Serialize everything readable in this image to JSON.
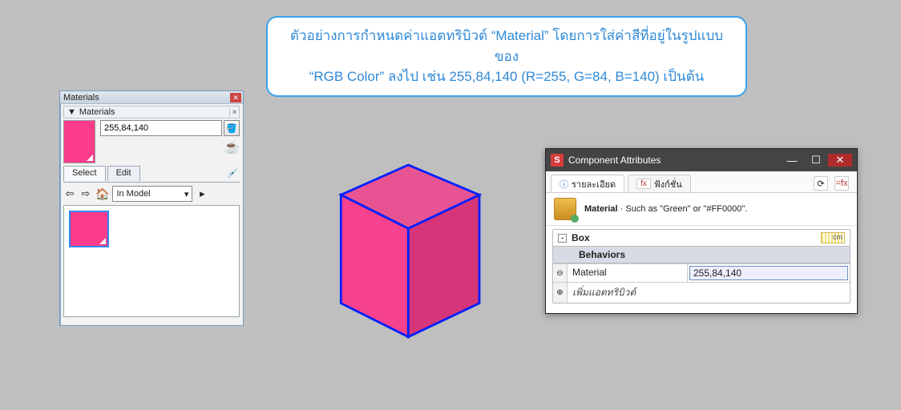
{
  "caption": {
    "line1": "ตัวอย่างการกำหนดค่าแอตทริบิวต์ “Material” โดยการใส่ค่าสีที่อยู่ในรูปแบบของ",
    "line2": "“RGB Color” ลงไป เช่น 255,84,140 (R=255, G=84, B=140) เป็นต้น"
  },
  "materials_panel": {
    "title": "Materials",
    "sub_title": "Materials",
    "name_value": "255,84,140",
    "tabs": {
      "select": "Select",
      "edit": "Edit"
    },
    "model_select": "In Model"
  },
  "ca_dialog": {
    "title": "Component Attributes",
    "tab_details": "รายละเอียด",
    "tab_functions": "ฟังก์ชั่น",
    "desc_label": "Material",
    "desc_text": " · Such as \"Green\" or \"#FF0000\".",
    "box_name": "Box",
    "unit": "cm",
    "behaviors_hdr": "Behaviors",
    "attr_name": "Material",
    "attr_value": "255,84,140",
    "add_attr": "เพิ่มแอตทริบิวต์"
  },
  "colors": {
    "material": "#fb3c8b",
    "accent": "#2f89d6"
  }
}
